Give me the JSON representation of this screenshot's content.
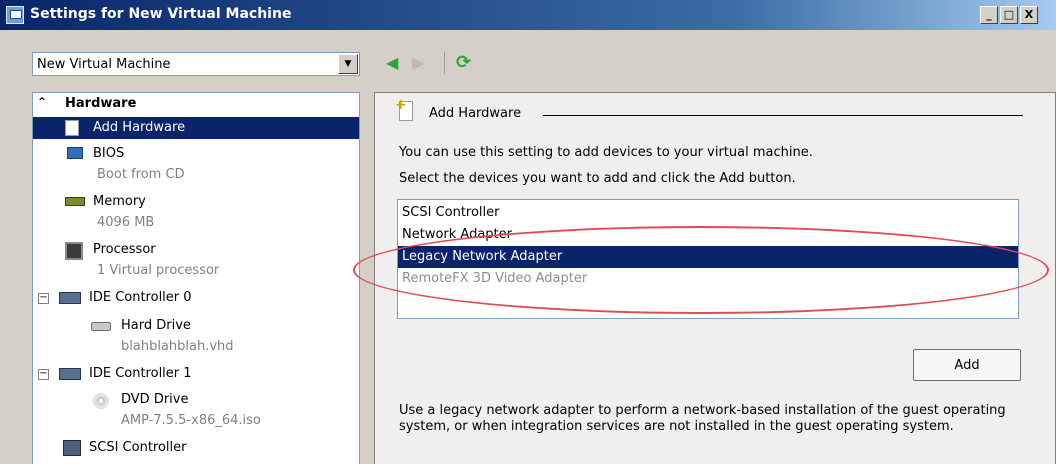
{
  "window": {
    "title": "Settings for New Virtual Machine",
    "min_label": "_",
    "max_label": "□",
    "close_label": "X"
  },
  "vm_selector": {
    "value": "New Virtual Machine",
    "arrow": "▼"
  },
  "nav": {
    "back": "◀",
    "forward": "▶",
    "refresh": "⟳"
  },
  "tree": {
    "header": "Hardware",
    "collapse_glyph": "⌃",
    "expander_glyph": "−",
    "items": [
      {
        "label": "Add Hardware",
        "icon": "add-hardware-icon"
      },
      {
        "label": "BIOS",
        "sub": "Boot from CD",
        "icon": "bios-icon"
      },
      {
        "label": "Memory",
        "sub": "4096 MB",
        "icon": "memory-icon"
      },
      {
        "label": "Processor",
        "sub": "1 Virtual processor",
        "icon": "processor-icon"
      },
      {
        "label": "IDE Controller 0",
        "icon": "ide-controller-icon"
      },
      {
        "label": "Hard Drive",
        "sub": "blahblahblah.vhd",
        "icon": "hard-drive-icon"
      },
      {
        "label": "IDE Controller 1",
        "icon": "ide-controller-icon"
      },
      {
        "label": "DVD Drive",
        "sub": "AMP-7.5.5-x86_64.iso",
        "icon": "dvd-drive-icon"
      },
      {
        "label": "SCSI Controller",
        "icon": "scsi-controller-icon"
      }
    ]
  },
  "panel": {
    "title": "Add Hardware",
    "line1": "You can use this setting to add devices to your virtual machine.",
    "line2": "Select the devices you want to add and click the Add button.",
    "devices": [
      "SCSI Controller",
      "Network Adapter",
      "Legacy Network Adapter",
      "RemoteFX 3D Video Adapter"
    ],
    "add_label": "Add",
    "note": "Use a legacy network adapter to perform a network-based installation of the guest operating system, or when integration services are not installed in the guest operating system."
  },
  "colors": {
    "selection": "#0a246a",
    "annotation": "#e04b55",
    "title_gradient_start": "#0a246a"
  }
}
